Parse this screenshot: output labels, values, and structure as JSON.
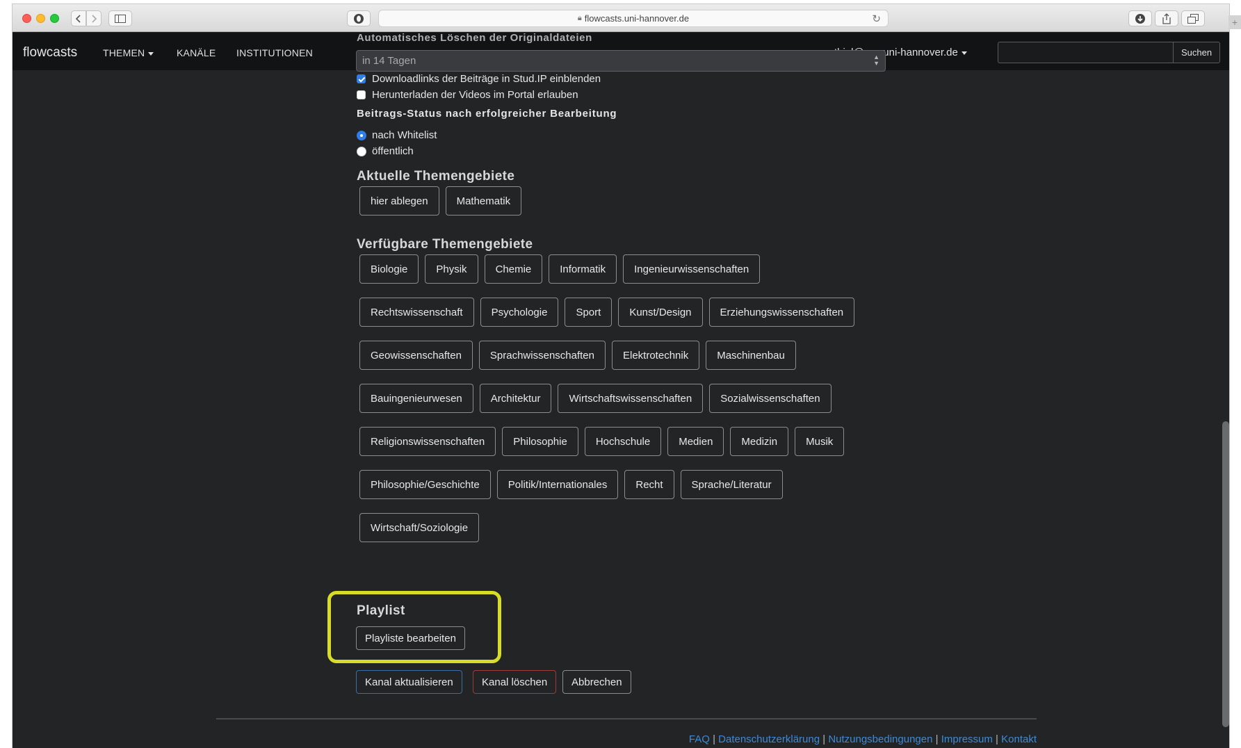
{
  "browser": {
    "url": "flowcasts.uni-hannover.de"
  },
  "navbar": {
    "brand": "flowcasts",
    "links": [
      "THEMEN",
      "KANÄLE",
      "INSTITUTIONEN"
    ],
    "user": "thiel@zqs.uni-hannover.de",
    "search_button": "Suchen"
  },
  "form": {
    "auto_delete_label": "Automatisches Löschen der Originaldateien",
    "auto_delete_value": "in 14 Tagen",
    "checkboxes": [
      {
        "label": "Downloadlinks der Beiträge in Stud.IP einblenden",
        "checked": true
      },
      {
        "label": "Herunterladen der Videos im Portal erlauben",
        "checked": false
      }
    ],
    "status_label": "Beitrags-Status nach erfolgreicher Bearbeitung",
    "radios": [
      {
        "label": "nach Whitelist",
        "checked": true
      },
      {
        "label": "öffentlich",
        "checked": false
      }
    ],
    "current_topics_heading": "Aktuelle Themengebiete",
    "current_topics": [
      "hier ablegen",
      "Mathematik"
    ],
    "available_topics_heading": "Verfügbare Themengebiete",
    "available_topics": [
      [
        "Biologie",
        "Physik",
        "Chemie",
        "Informatik",
        "Ingenieurwissenschaften"
      ],
      [
        "Rechtswissenschaft",
        "Psychologie",
        "Sport",
        "Kunst/Design",
        "Erziehungswissenschaften"
      ],
      [
        "Geowissenschaften",
        "Sprachwissenschaften",
        "Elektrotechnik",
        "Maschinenbau"
      ],
      [
        "Bauingenieurwesen",
        "Architektur",
        "Wirtschaftswissenschaften",
        "Sozialwissenschaften"
      ],
      [
        "Religionswissenschaften",
        "Philosophie",
        "Hochschule",
        "Medien",
        "Medizin",
        "Musik"
      ],
      [
        "Philosophie/Geschichte",
        "Politik/Internationales",
        "Recht",
        "Sprache/Literatur"
      ],
      [
        "Wirtschaft/Soziologie"
      ]
    ],
    "playlist_heading": "Playlist",
    "playlist_button": "Playliste bearbeiten",
    "actions": {
      "update": "Kanal aktualisieren",
      "delete": "Kanal löschen",
      "cancel": "Abbrechen"
    }
  },
  "footer": {
    "links": [
      "FAQ",
      "Datenschutzerklärung",
      "Nutzungsbedingungen",
      "Impressum",
      "Kontakt"
    ],
    "separator": "|"
  },
  "colors": {
    "highlight": "#d7dc28",
    "link": "#3e8ad6",
    "background": "#222426"
  }
}
